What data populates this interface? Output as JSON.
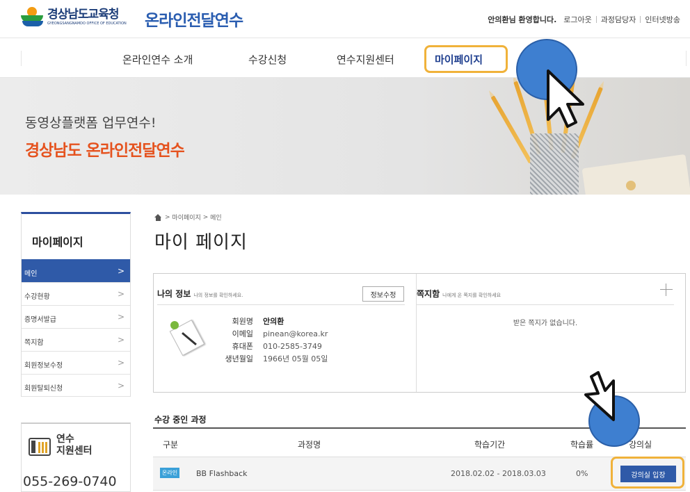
{
  "header": {
    "logo_kr": "경상남도교육청",
    "logo_en": "GYEONGSANGNAMDO OFFICE OF EDUCATION",
    "site_title": "온라인전달연수",
    "welcome": "안의환님 환영합니다.",
    "links": [
      "로그아웃",
      "과정담당자",
      "인터넷방송"
    ]
  },
  "nav": {
    "items": [
      "온라인연수 소개",
      "수강신청",
      "연수지원센터",
      "마이페이지"
    ],
    "active": "마이페이지"
  },
  "banner": {
    "sub": "동영상플랫폼 업무연수!",
    "main": "경상남도 온라인전달연수"
  },
  "sidebar": {
    "title": "마이페이지",
    "items": [
      {
        "label": "메인"
      },
      {
        "label": "수강현황"
      },
      {
        "label": "증명서발급"
      },
      {
        "label": "쪽지함"
      },
      {
        "label": "회원정보수정"
      },
      {
        "label": "회원탈퇴신청"
      }
    ],
    "chevron": ">",
    "support_line1": "연수",
    "support_line2": "지원센터",
    "support_phone": "055-269-0740"
  },
  "breadcrumb": {
    "sep": ">",
    "items": [
      "마이페이지",
      "메인"
    ]
  },
  "page_title": "마이 페이지",
  "my_info": {
    "title": "나의 정보",
    "hint": "나의 정보를 확인하세요.",
    "edit_label": "정보수정",
    "rows": [
      {
        "label": "회원명",
        "value": "안의환"
      },
      {
        "label": "이메일",
        "value": "pinean@korea.kr"
      },
      {
        "label": "휴대폰",
        "value": "010-2585-3749"
      },
      {
        "label": "생년월일",
        "value": "1966년 05월 05일"
      }
    ]
  },
  "messages": {
    "title": "쪽지함",
    "hint": "나에게 온 쪽지를 확인하세요",
    "empty": "받은 쪽지가 없습니다."
  },
  "courses": {
    "title": "수강 중인 과정",
    "headers": [
      "구분",
      "과정명",
      "학습기간",
      "학습률",
      "강의실"
    ],
    "rows": [
      {
        "type": "온라인",
        "name": "BB Flashback",
        "period": "2018.02.02 - 2018.03.03",
        "rate": "0%",
        "action": "강의실 입장"
      }
    ]
  },
  "colors": {
    "accent": "#2f5aa8",
    "banner_main": "#e5521e",
    "highlight": "#f0b23a",
    "cursor_dot": "#3e7fd0"
  }
}
